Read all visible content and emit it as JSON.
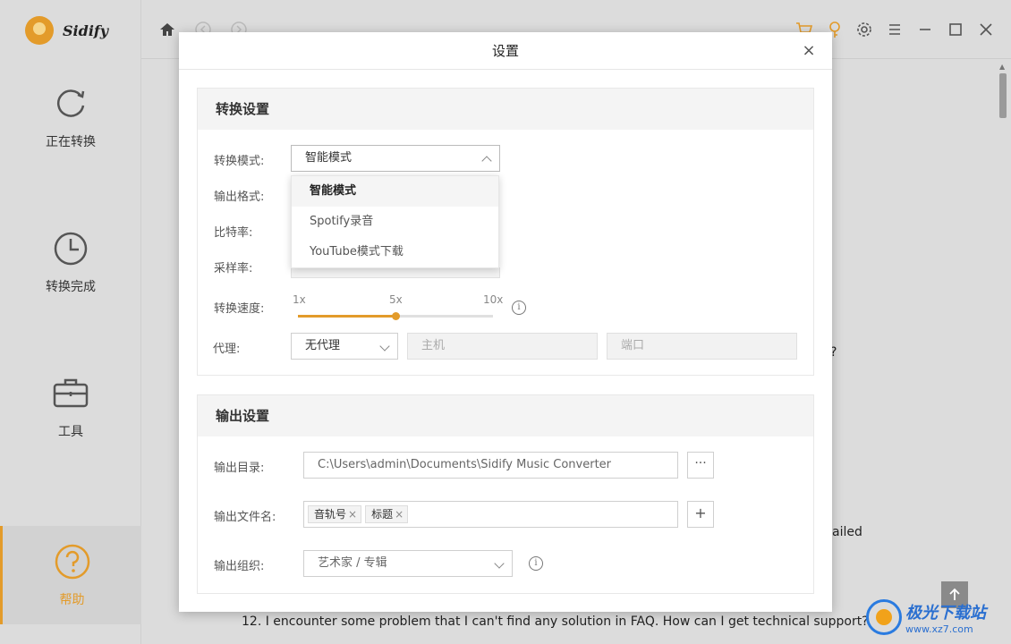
{
  "app": {
    "name": "Sidify"
  },
  "sidebar": {
    "items": [
      {
        "label": "正在转换",
        "icon": "refresh-icon"
      },
      {
        "label": "转换完成",
        "icon": "clock-icon"
      },
      {
        "label": "工具",
        "icon": "toolbox-icon"
      },
      {
        "label": "帮助",
        "icon": "help-icon"
      }
    ]
  },
  "topbar": {
    "icons": [
      "home-icon",
      "back-icon",
      "forward-icon",
      "cart-icon",
      "key-icon",
      "gear-icon",
      "menu-icon",
      "minimize-icon",
      "maximize-icon",
      "close-icon"
    ]
  },
  "background": {
    "partial_q": "?",
    "partial_failed": "ailed",
    "faq12": "12. I encounter some problem that I can't find any solution in FAQ. How can I get technical support?"
  },
  "dialog": {
    "title": "设置",
    "close": "×",
    "convert": {
      "title": "转换设置",
      "mode_label": "转换模式:",
      "mode_value": "智能模式",
      "mode_options": [
        "智能模式",
        "Spotify录音",
        "YouTube模式下载"
      ],
      "format_label": "输出格式:",
      "bitrate_label": "比特率:",
      "samplerate_label": "采样率:",
      "speed_label": "转换速度:",
      "speed_ticks": [
        "1x",
        "5x",
        "10x"
      ],
      "speed_value_fraction": 0.5,
      "proxy_label": "代理:",
      "proxy_value": "无代理",
      "host_placeholder": "主机",
      "port_placeholder": "端口"
    },
    "output": {
      "title": "输出设置",
      "dir_label": "输出目录:",
      "dir_value": "C:\\Users\\admin\\Documents\\Sidify Music Converter",
      "browse": "···",
      "filename_label": "输出文件名:",
      "tags": [
        "音轨号",
        "标题"
      ],
      "add": "+",
      "org_label": "输出组织:",
      "org_value": "艺术家 / 专辑"
    }
  },
  "watermark": {
    "cn": "极光下载站",
    "url": "www.xz7.com"
  },
  "colors": {
    "accent": "#e39b2a"
  }
}
